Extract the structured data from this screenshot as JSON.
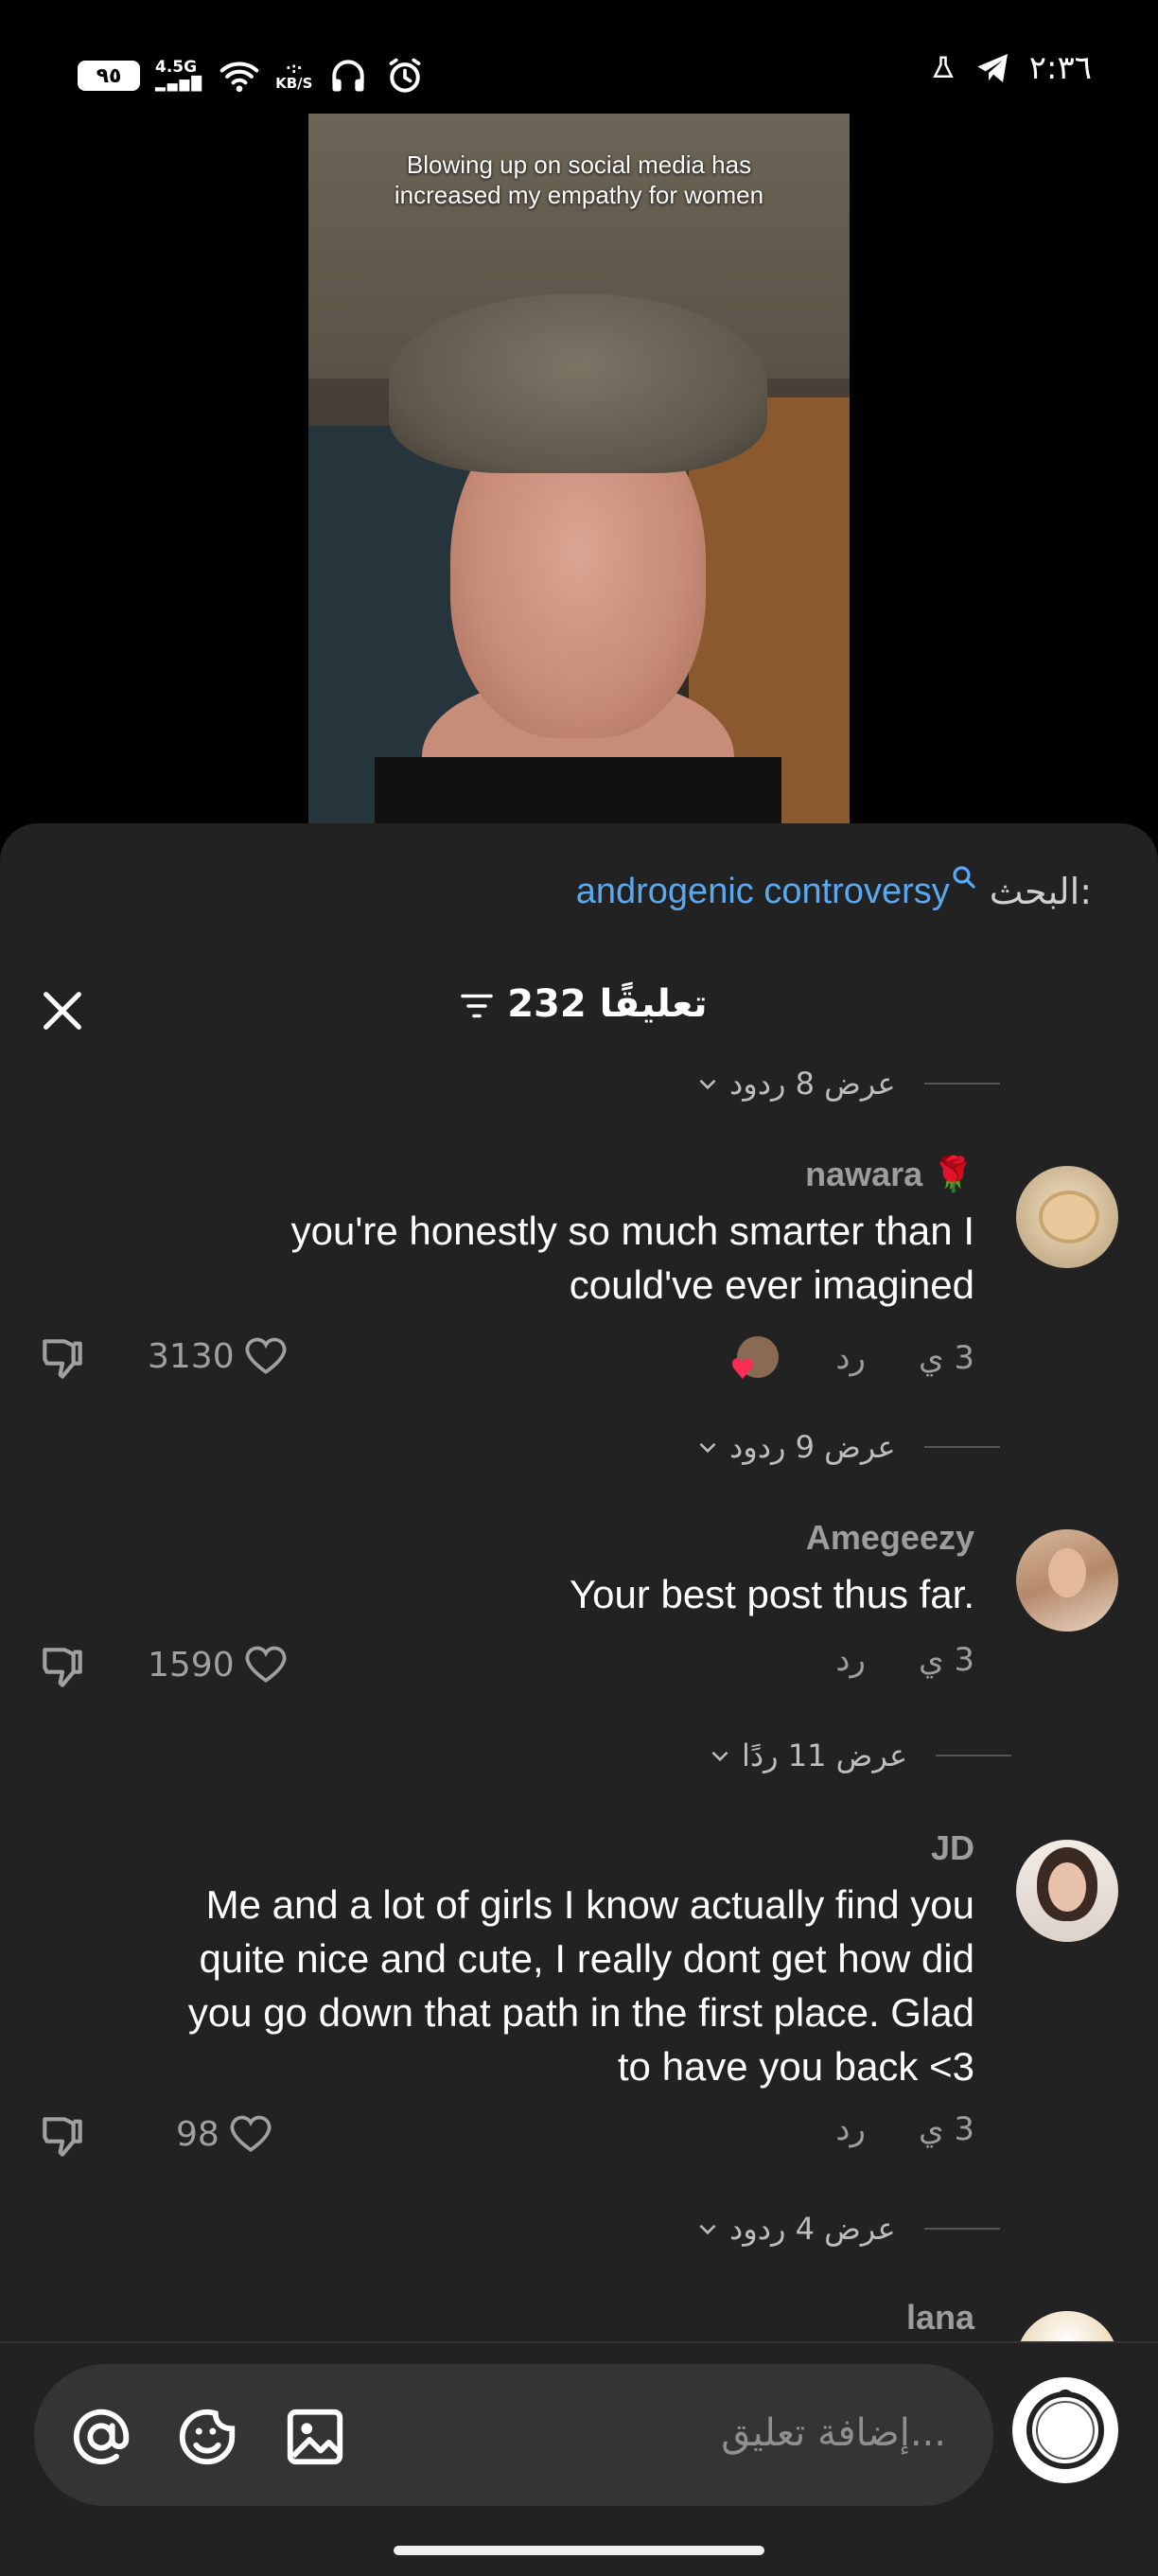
{
  "status_bar": {
    "time": "٢:٣٦",
    "battery": "٩٥",
    "network": "4.5G",
    "speed_unit": "KB/S"
  },
  "video": {
    "caption_line1": "Blowing up on social media has",
    "caption_line2": "increased my empathy for women"
  },
  "search": {
    "prefix": "البحث:",
    "query": "androgenic controversy"
  },
  "comments_header": {
    "title": "232 تعليقًا"
  },
  "reply_toggles": [
    "عرض 8 ردود",
    "عرض 9 ردود",
    "عرض 11 ردًا",
    "عرض 4 ردود"
  ],
  "comments": [
    {
      "username": "nawara 🌹",
      "text_lines": [
        "you're honestly so much smarter than I",
        "could've ever imagined"
      ],
      "age": "3 ي",
      "reply_label": "رد",
      "likes": "3130"
    },
    {
      "username": "Amegeezy",
      "text_lines": [
        "Your best post thus far."
      ],
      "age": "3 ي",
      "reply_label": "رد",
      "likes": "1590"
    },
    {
      "username": "JD",
      "text_lines": [
        "Me and a lot of girls I know actually find you",
        "quite nice and cute, I really dont get how did",
        "you go down that path in the first place. Glad",
        "to have you back <3"
      ],
      "age": "3 ي",
      "reply_label": "رد",
      "likes": "98"
    },
    {
      "username": "lana"
    }
  ],
  "composer": {
    "placeholder": "إضافة تعليق..."
  },
  "colors": {
    "sheet_bg": "#222222",
    "link_blue": "#5aa8f0",
    "muted_text": "#9d9d9d"
  }
}
